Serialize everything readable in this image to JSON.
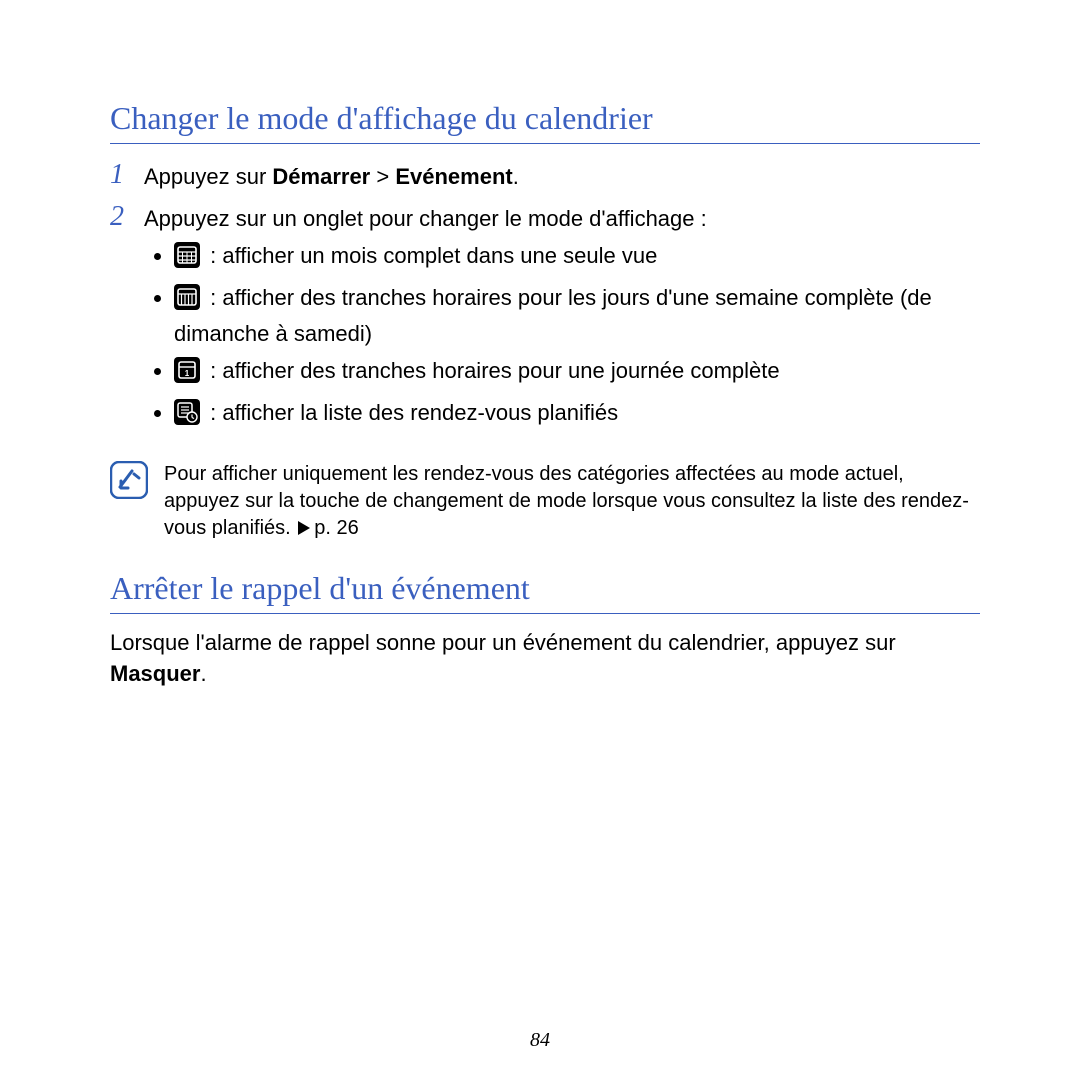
{
  "section1": {
    "title": "Changer le mode d'affichage du calendrier",
    "step1": {
      "num": "1",
      "prefix": "Appuyez sur ",
      "bold1": "Démarrer",
      "mid": " > ",
      "bold2": "Evénement",
      "suffix": "."
    },
    "step2": {
      "num": "2",
      "text": "Appuyez sur un onglet pour changer le mode d'affichage :",
      "bullets": [
        " : afficher un mois complet dans une seule vue",
        " : afficher des tranches horaires pour les jours d'une semaine complète (de dimanche à samedi)",
        " : afficher des tranches horaires pour une journée complète",
        " : afficher la liste des rendez-vous planifiés"
      ]
    },
    "note": {
      "text_before": "Pour afficher uniquement les rendez-vous des catégories affectées au mode actuel, appuyez sur la touche de changement de mode lorsque vous consultez la liste des rendez-vous planifiés. ",
      "page_ref": "p. 26"
    }
  },
  "section2": {
    "title": "Arrêter le rappel d'un événement",
    "para_before": "Lorsque l'alarme de rappel sonne pour un événement du calendrier, appuyez sur ",
    "bold": "Masquer",
    "para_after": "."
  },
  "page_number": "84"
}
